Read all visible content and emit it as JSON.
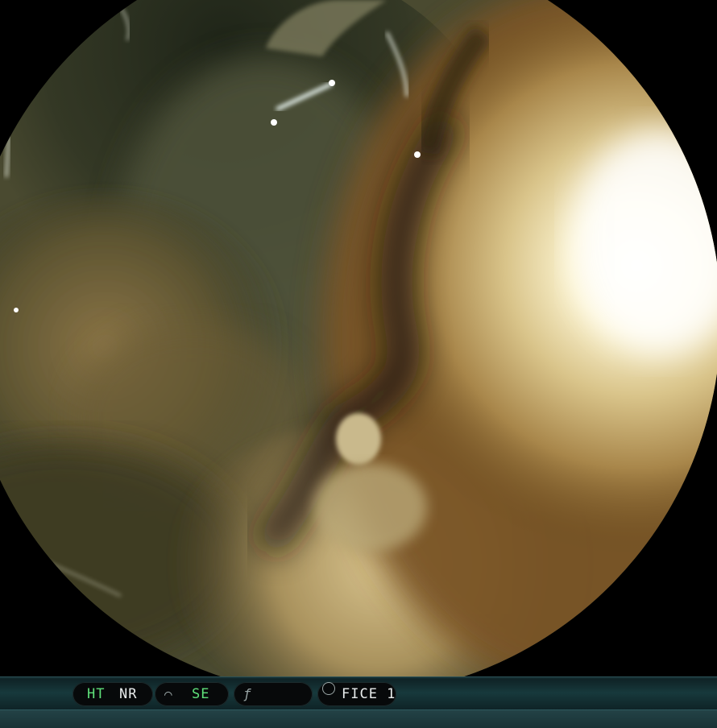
{
  "status_bar": {
    "items": [
      {
        "label": "HT",
        "color": "#5fe07a"
      },
      {
        "label": "NR",
        "color": "#e8ecec"
      },
      {
        "icon": "enhance-curve-icon"
      },
      {
        "label": "SE",
        "color": "#5fe07a"
      },
      {
        "icon": "function-f-icon"
      },
      {
        "icon": "fice-waveform-icon"
      },
      {
        "label": "FICE 1",
        "color": "#e8ecec"
      }
    ]
  }
}
